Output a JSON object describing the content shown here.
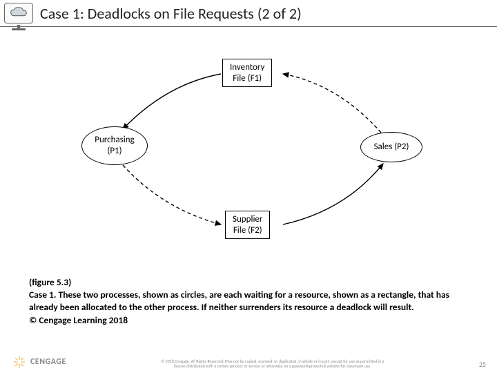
{
  "header": {
    "title": "Case 1: Deadlocks on File Requests (2 of 2)"
  },
  "diagram": {
    "f1_l1": "Inventory",
    "f1_l2": "File (F1)",
    "f2_l1": "Supplier",
    "f2_l2": "File (F2)",
    "p1_l1": "Purchasing",
    "p1_l2": "(P1)",
    "p2": "Sales (P2)"
  },
  "caption": {
    "fig": "(figure 5.3)",
    "body": "Case 1. These two processes, shown as circles, are each waiting for a resource, shown as a rectangle, that has already been allocated to the other process. If neither surrenders its resource a deadlock will result.",
    "credit": "© Cengage Learning 2018"
  },
  "footer": {
    "brand": "CENGAGE",
    "copyright_l1": "© 2018 Cengage. All Rights Reserved. May not be copied, scanned, or duplicated, in whole or in part, except for use as permitted in a",
    "copyright_l2": "license distributed with a certain product or service or otherwise on a password-protected website for classroom use.",
    "page": "25"
  }
}
